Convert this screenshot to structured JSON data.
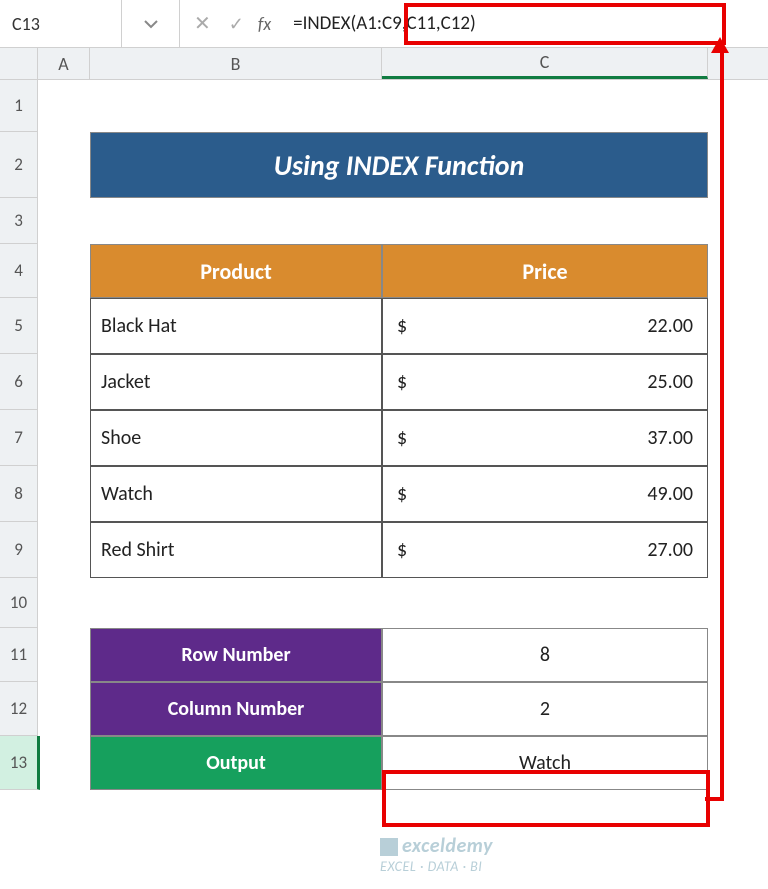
{
  "nameBox": "C13",
  "formula": "=INDEX(A1:C9,C11,C12)",
  "columns": {
    "A": "A",
    "B": "B",
    "C": "C"
  },
  "rows": [
    "1",
    "2",
    "3",
    "4",
    "5",
    "6",
    "7",
    "8",
    "9",
    "10",
    "11",
    "12",
    "13"
  ],
  "title": "Using INDEX Function",
  "headers": {
    "product": "Product",
    "price": "Price"
  },
  "currency": "$",
  "products": [
    {
      "name": "Black Hat",
      "price": "22.00"
    },
    {
      "name": "Jacket",
      "price": "25.00"
    },
    {
      "name": "Shoe",
      "price": "37.00"
    },
    {
      "name": "Watch",
      "price": "49.00"
    },
    {
      "name": "Red Shirt",
      "price": "27.00"
    }
  ],
  "lookup": {
    "rowLabel": "Row Number",
    "colLabel": "Column Number",
    "outLabel": "Output",
    "rowValue": "8",
    "colValue": "2",
    "outValue": "Watch"
  },
  "watermark": {
    "brand": "exceldemy",
    "tag": "EXCEL · DATA · BI"
  }
}
